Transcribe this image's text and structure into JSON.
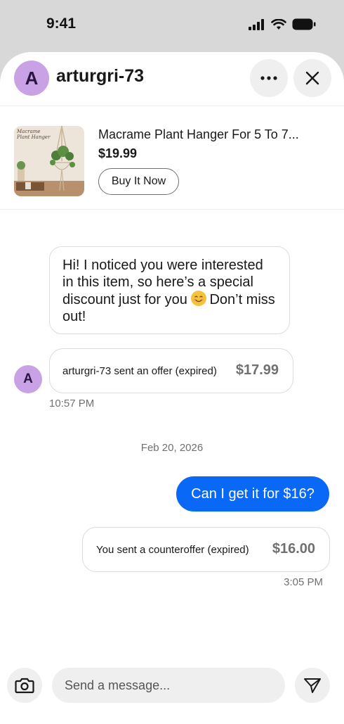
{
  "status_bar": {
    "time": "9:41",
    "icons": [
      "signal-icon",
      "wifi-icon",
      "battery-icon"
    ]
  },
  "header": {
    "avatar_initial": "A",
    "username": "arturgri-73",
    "avatar_color": "#c9a2e6",
    "more_icon": "ellipsis-icon",
    "close_icon": "close-icon"
  },
  "item": {
    "title": "Macrame Plant Hanger For 5 To 7...",
    "price": "$19.99",
    "buy_label": "Buy It Now",
    "thumb_caption": "Macrame Plant Hanger"
  },
  "messages": {
    "incoming_text_1": "Hi! I noticed you were interested in this item, so here’s a special discount just for you",
    "incoming_text_2": "Don’t miss out!",
    "offer_text": "arturgri-73 sent an offer (expired)",
    "offer_price": "$17.99",
    "offer_time": "10:57 PM",
    "date_separator": "Feb 20, 2026",
    "outgoing_text": "Can I get it for $16?",
    "counter_text": "You sent a counteroffer (expired)",
    "counter_price": "$16.00",
    "counter_time": "3:05 PM",
    "sender_initial": "A"
  },
  "composer": {
    "placeholder": "Send a message...",
    "camera_icon": "camera-icon",
    "send_icon": "send-icon"
  },
  "colors": {
    "accent": "#0968f6",
    "muted": "#707070",
    "avatar": "#c9a2e6"
  }
}
